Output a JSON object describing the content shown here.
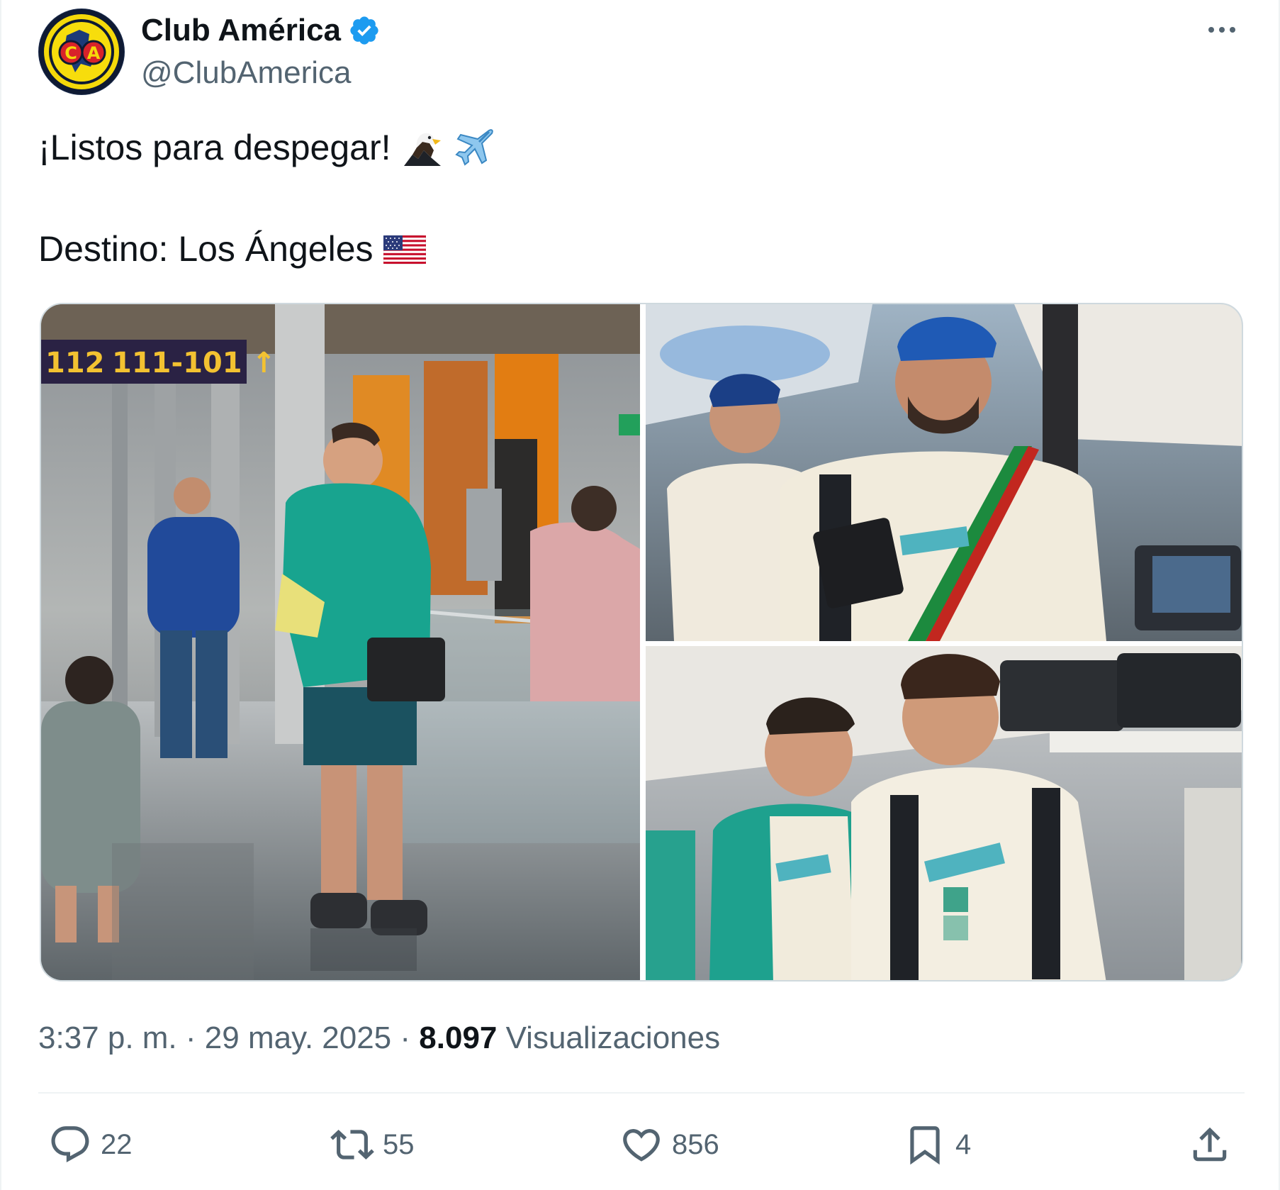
{
  "author": {
    "display_name": "Club América",
    "handle": "@ClubAmerica",
    "avatar_icon": "club-america-crest",
    "verified": true
  },
  "tweet": {
    "line1": "¡Listos para despegar!",
    "line1_emojis": [
      "eagle-emoji",
      "airplane-emoji"
    ],
    "line2": "Destino: Los Ángeles",
    "line2_emojis": [
      "us-flag-emoji"
    ]
  },
  "media": {
    "count": 3,
    "photos": [
      "airport-terminal-photo",
      "airplane-cabin-photo-1",
      "airplane-cabin-photo-2"
    ]
  },
  "meta": {
    "time": "3:37 p. m.",
    "separator": "·",
    "date": "29 may. 2025",
    "views_count": "8.097",
    "views_label": "Visualizaciones"
  },
  "actions": {
    "replies": "22",
    "retweets": "55",
    "likes": "856",
    "bookmarks": "4"
  },
  "colors": {
    "text_primary": "#0f1419",
    "text_secondary": "#536471",
    "verified_blue": "#1d9bf0",
    "border": "#cfd9de"
  }
}
